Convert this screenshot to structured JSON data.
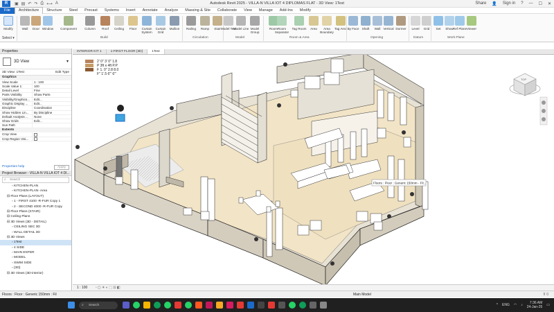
{
  "app": {
    "title": "Autodesk Revit 2025 - VILLA-N VILLA IOT 4 DIPLOMAS FLAT - 3D View: 1Test",
    "logo": "R",
    "quick_access": [
      "open-icon",
      "save-icon",
      "undo-icon",
      "redo-icon",
      "print-icon",
      "measure-icon",
      "text-icon"
    ],
    "share_label": "Share",
    "signin_label": "Sign in",
    "help_label": "?"
  },
  "ribbon_tabs": [
    "File",
    "Architecture",
    "Structure",
    "Steel",
    "Precast",
    "Systems",
    "Insert",
    "Annotate",
    "Analyze",
    "Massing & Site",
    "Collaborate",
    "View",
    "Manage",
    "Add-Ins",
    "Modify"
  ],
  "ribbon": {
    "select": {
      "modify": "Modify",
      "group": "Select"
    },
    "build": {
      "items": [
        "Wall",
        "Door",
        "Window",
        "Component",
        "Column",
        "Roof",
        "Ceiling",
        "Floor",
        "Curtain System",
        "Curtain Grid",
        "Mullion"
      ],
      "group": "Build"
    },
    "circulation": {
      "items": [
        "Railing",
        "Ramp",
        "Stair"
      ],
      "group": "Circulation"
    },
    "model": {
      "items": [
        "Model Text",
        "Model Line",
        "Model Group"
      ],
      "group": "Model"
    },
    "room_area": {
      "items": [
        "Room",
        "Room Separator",
        "Tag Room",
        "Area",
        "Area Boundary",
        "Tag Area"
      ],
      "group": "Room & Area"
    },
    "opening": {
      "items": [
        "By Face",
        "Shaft",
        "Wall",
        "Vertical",
        "Dormer"
      ],
      "group": "Opening"
    },
    "datum": {
      "items": [
        "Level",
        "Grid"
      ],
      "group": "Datum"
    },
    "work_plane": {
      "items": [
        "Set",
        "Show",
        "Ref Plane",
        "Viewer"
      ],
      "group": "Work Plane"
    },
    "select_dropdown": "Select ▾"
  },
  "properties": {
    "title": "Properties",
    "type_name": "3D View",
    "type_selector_value": "3D View: 1Test",
    "edit_type": "Edit Type",
    "sections": {
      "graphics": "Graphics",
      "extents": "Extents"
    },
    "rows": [
      {
        "k": "View Scale",
        "v": "1 : 100"
      },
      {
        "k": "Scale Value 1:",
        "v": "100"
      },
      {
        "k": "Detail Level",
        "v": "Fine"
      },
      {
        "k": "Parts Visibility",
        "v": "Show Parts"
      },
      {
        "k": "Visibility/Graphics...",
        "v": "Edit..."
      },
      {
        "k": "Graphic Display ...",
        "v": "Edit..."
      },
      {
        "k": "Discipline",
        "v": "Coordination"
      },
      {
        "k": "Show Hidden Lin...",
        "v": "By Discipline"
      },
      {
        "k": "Default Analysis ...",
        "v": "None"
      },
      {
        "k": "Show Grids",
        "v": "Edit..."
      },
      {
        "k": "Sun Path",
        "v": ""
      }
    ],
    "extent_rows": [
      {
        "k": "Crop View",
        "v": ""
      },
      {
        "k": "Crop Region Visi...",
        "v": ""
      }
    ],
    "help_link": "Properties help",
    "apply": "Apply"
  },
  "project_browser": {
    "title": "Project Browser - VILLA-N VILLA IOT 4 DI...",
    "search_placeholder": "Search",
    "items": [
      {
        "text": "KITCHEN-PLAN",
        "indent": 2
      },
      {
        "text": "KITCHEN-PLAN- Area",
        "indent": 2
      },
      {
        "text": "Floor Plans (LAYOUT)",
        "indent": 1
      },
      {
        "text": "1 - FIRST 4100 -R-FUR Copy 1",
        "indent": 2
      },
      {
        "text": "2 - SECOND 4000 -R-FUR Copy",
        "indent": 2
      },
      {
        "text": "Floor Plans (STAIR)",
        "indent": 1
      },
      {
        "text": "Ceiling Plans",
        "indent": 1
      },
      {
        "text": "3D Views (3D - DETAIL)",
        "indent": 1
      },
      {
        "text": "CEILING SEC 3D",
        "indent": 2
      },
      {
        "text": "WALL DETAIL 3D",
        "indent": 2
      },
      {
        "text": "3D Views",
        "indent": 1
      },
      {
        "text": "1Test",
        "indent": 2,
        "selected": true
      },
      {
        "text": "4 SIDE",
        "indent": 2
      },
      {
        "text": "MAIN ENTER",
        "indent": 2
      },
      {
        "text": "MODEL",
        "indent": 2
      },
      {
        "text": "SWIM SIDE",
        "indent": 2
      },
      {
        "text": "{3D}",
        "indent": 2
      },
      {
        "text": "3D Views (3D-interior)",
        "indent": 1
      }
    ]
  },
  "document_tabs": [
    "INTERIOR KIT 1",
    "1-FIRST FLOOR {3D}",
    "1Test"
  ],
  "viewport": {
    "tooltip": "Floors : Floor : Generic 150mm - Fil...",
    "legend_text": [
      "2' 0\" 3' 0\"  1.8",
      "P  3ft x 4ft  P.P",
      "F  1. 0\"  2.8  8.0",
      "F\"  1'.5  6'\"  6'\""
    ],
    "viewcube_face": "TOP",
    "scale": "1 : 100"
  },
  "status_bar": {
    "text": "Floors : Floor : Generic 150mm : Fil",
    "main_model": "Main Model"
  },
  "taskbar": {
    "search_placeholder": "Search",
    "language": "ENG",
    "time": "7:36 AM",
    "date": "24-Jan-25"
  },
  "colors": {
    "accent": "#1b6ac9",
    "floor": "#f2e4c6",
    "wall_side": "#ddd8cc",
    "wall_top": "#f0ece4",
    "line": "#2b2b2b"
  }
}
